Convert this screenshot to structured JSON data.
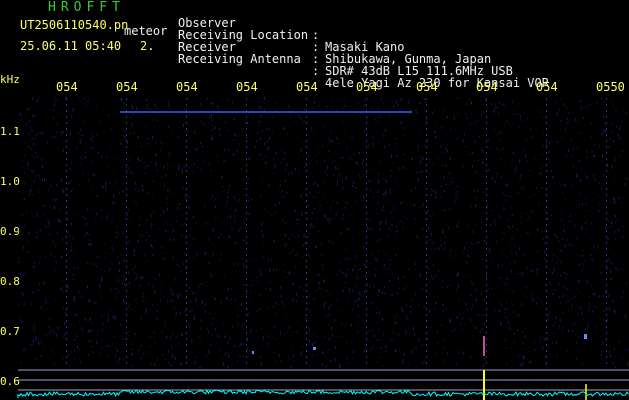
{
  "header": {
    "title": "HROFFT",
    "filename": "UT2506110540.pn",
    "detector_label": "meteor",
    "datetime": "25.06.11 05:40",
    "count": "2.",
    "info": [
      {
        "label": "Observer",
        "value": "Masaki Kano"
      },
      {
        "label": "Receiving Location",
        "value": "Shibukawa, Gunma, Japan"
      },
      {
        "label": "Receiver",
        "value": "SDR# 43dB L15 111.6MHz USB"
      },
      {
        "label": "Receiving Antenna",
        "value": "4ele Yagi Az 230 for Kansai VOR"
      }
    ],
    "colon": ":"
  },
  "axis": {
    "unit": "kHz",
    "x_ticks": [
      "054",
      "054",
      "054",
      "054",
      "054",
      "054",
      "054",
      "054",
      "054",
      "0550"
    ],
    "y_ticks": [
      "1.1",
      "1.0",
      "0.9",
      "0.8",
      "0.7",
      "0.6"
    ]
  },
  "colors": {
    "label_yellow": "#ffff66",
    "title_green": "#33cc33",
    "background": "#000000",
    "noise": "#1a2a80",
    "grid": "#3040a0",
    "trace": "#4080ff",
    "reference_line": "#a0a0d0",
    "signal_cyan": "#00ffff",
    "echo_yellow": "#ffff00"
  }
}
